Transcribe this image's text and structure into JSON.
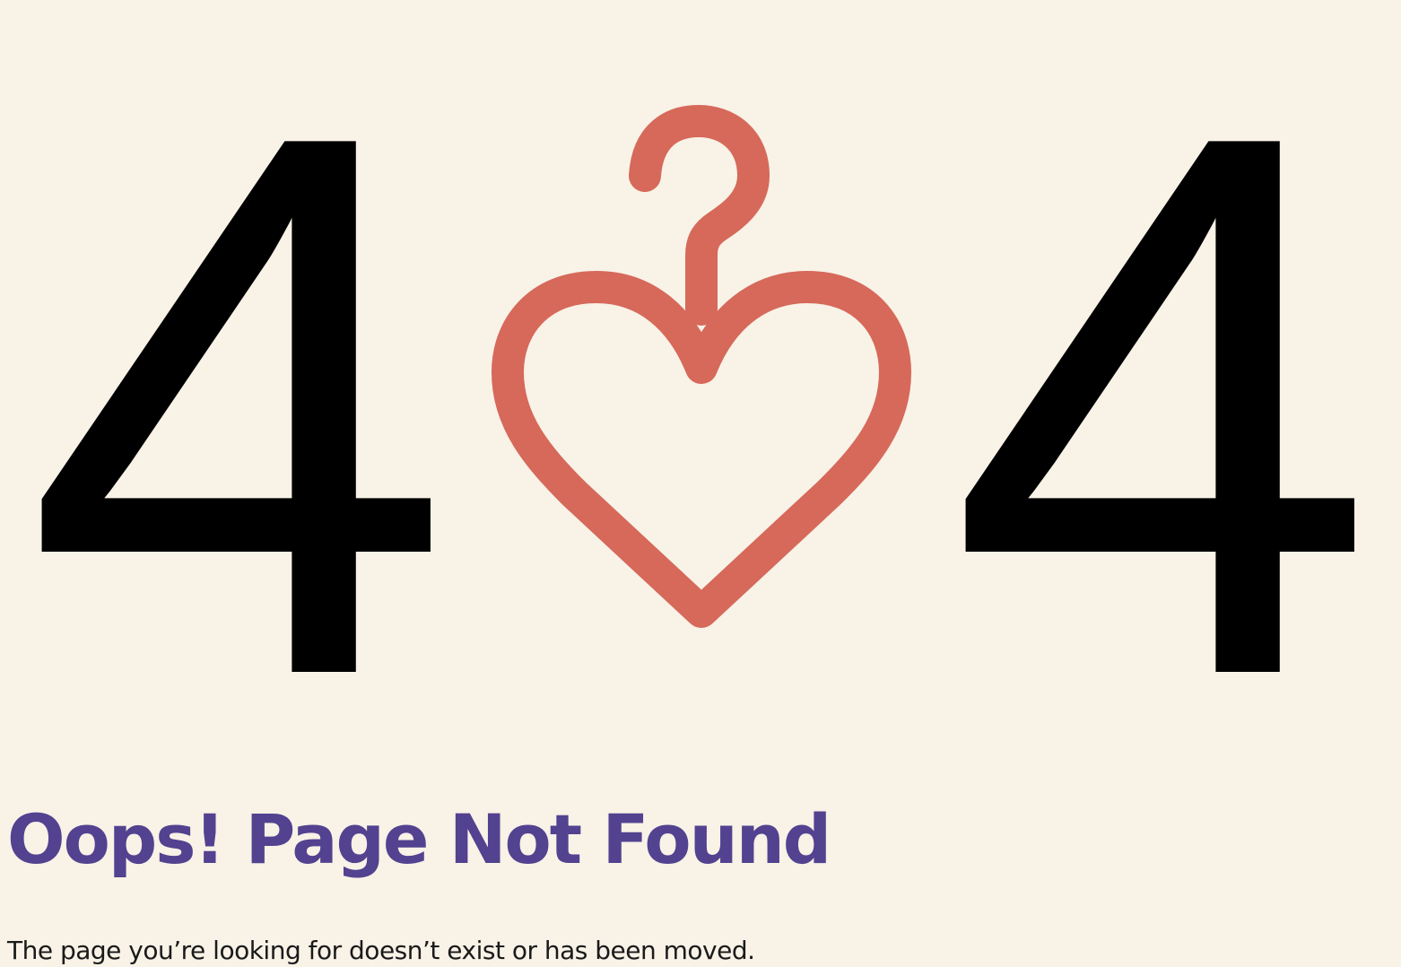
{
  "error": {
    "code_left_digit": "4",
    "code_right_digit": "4",
    "center_icon": "heart-hanger-icon"
  },
  "heading": "Oops! Page Not Found",
  "message": "The page you’re looking for doesn’t exist or has been moved.",
  "colors": {
    "background": "#F8F2E7",
    "digits": "#000000",
    "icon": "#D6695A",
    "heading": "#52428F",
    "text": "#1A1A1A"
  }
}
